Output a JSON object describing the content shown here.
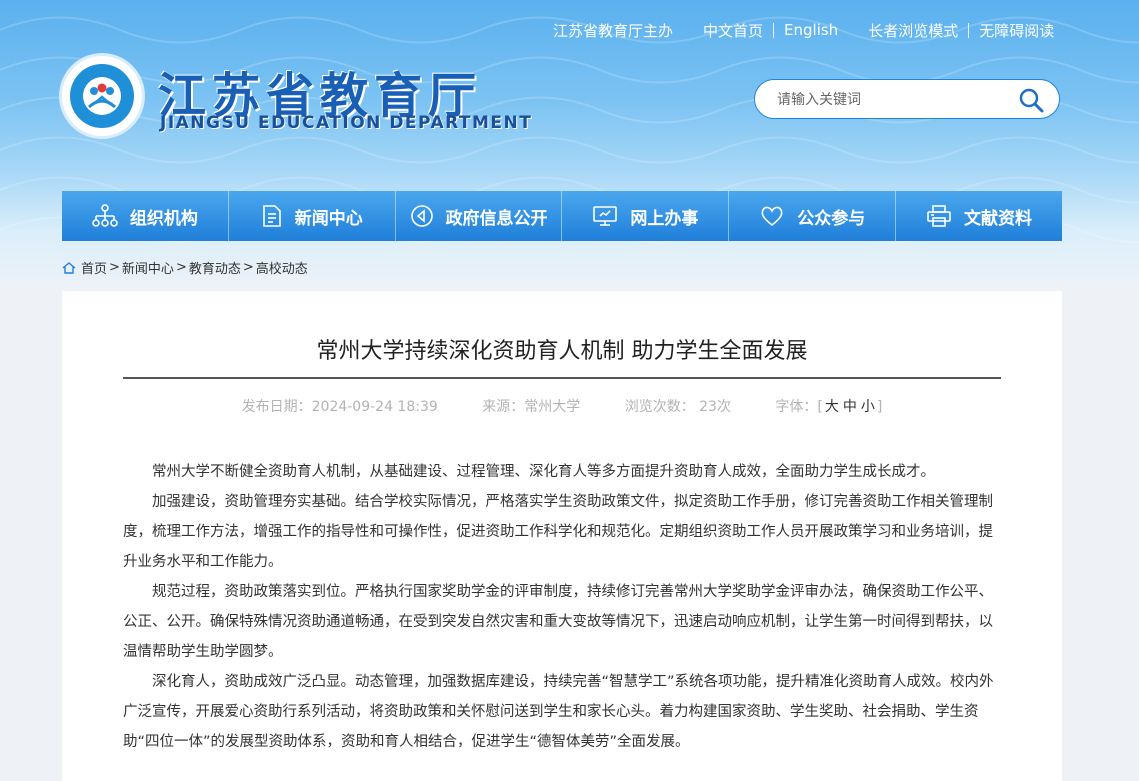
{
  "header": {
    "links": [
      "江苏省教育厅主办",
      "中文首页",
      "English",
      "长者浏览模式",
      "无障碍阅读"
    ],
    "title": "江苏省教育厅",
    "subtitle": "JIANGSU EDUCATION DEPARTMENT",
    "search_placeholder": "请输入关键词"
  },
  "nav": [
    {
      "label": "组织机构",
      "icon": "org-chart-icon"
    },
    {
      "label": "新闻中心",
      "icon": "document-icon"
    },
    {
      "label": "政府信息公开",
      "icon": "speaker-icon"
    },
    {
      "label": "网上办事",
      "icon": "monitor-icon"
    },
    {
      "label": "公众参与",
      "icon": "heart-icon"
    },
    {
      "label": "文献资料",
      "icon": "printer-icon"
    }
  ],
  "breadcrumb": [
    "首页",
    "新闻中心",
    "教育动态",
    "高校动态"
  ],
  "article": {
    "title": "常州大学持续深化资助育人机制 助力学生全面发展",
    "date": "发布日期：2024-09-24 18:39",
    "source": "来源：常州大学",
    "views": "浏览次数：  23次",
    "font_label": "字体：",
    "font_sizes": [
      "大",
      "中",
      "小"
    ],
    "paragraphs": [
      "常州大学不断健全资助育人机制，从基础建设、过程管理、深化育人等多方面提升资助育人成效，全面助力学生成长成才。",
      "加强建设，资助管理夯实基础。结合学校实际情况，严格落实学生资助政策文件，拟定资助工作手册，修订完善资助工作相关管理制度，梳理工作方法，增强工作的指导性和可操作性，促进资助工作科学化和规范化。定期组织资助工作人员开展政策学习和业务培训，提升业务水平和工作能力。",
      "规范过程，资助政策落实到位。严格执行国家奖助学金的评审制度，持续修订完善常州大学奖助学金评审办法，确保资助工作公平、公正、公开。确保特殊情况资助通道畅通，在受到突发自然灾害和重大变故等情况下，迅速启动响应机制，让学生第一时间得到帮扶，以温情帮助学生助学圆梦。",
      "深化育人，资助成效广泛凸显。动态管理，加强数据库建设，持续完善“智慧学工”系统各项功能，提升精准化资助育人成效。校内外广泛宣传，开展爱心资助行系列活动，将资助政策和关怀慰问送到学生和家长心头。着力构建国家资助、学生奖助、社会捐助、学生资助“四位一体”的发展型资助体系，资助和育人相结合，促进学生“德智体美劳”全面发展。"
    ]
  }
}
